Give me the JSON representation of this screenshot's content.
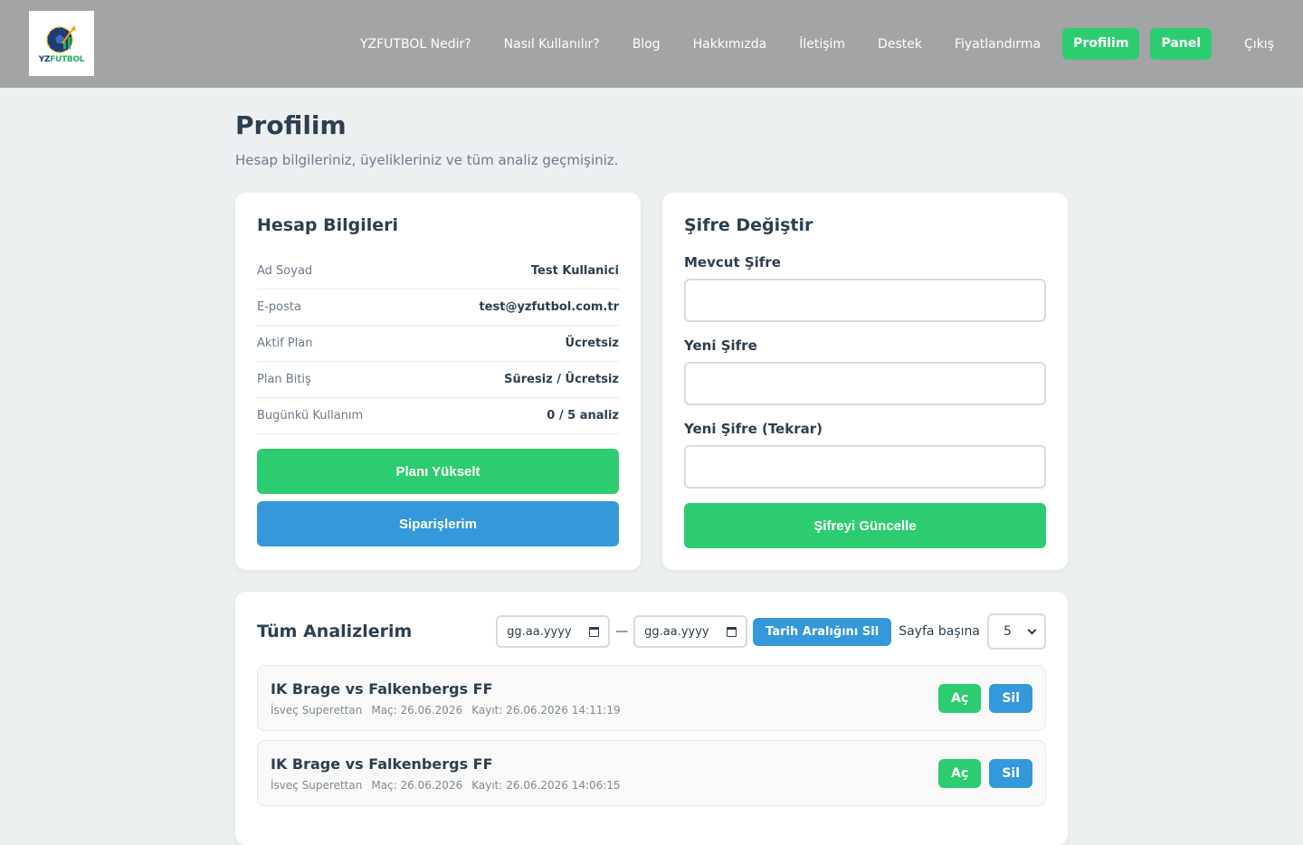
{
  "header": {
    "logo_text_a": "YZ",
    "logo_text_b": "FUTBOL",
    "nav": [
      {
        "label": "YZFUTBOL Nedir?"
      },
      {
        "label": "Nasıl Kullanılır?"
      },
      {
        "label": "Blog"
      },
      {
        "label": "Hakkımızda"
      },
      {
        "label": "İletişim"
      },
      {
        "label": "Destek"
      },
      {
        "label": "Fiyatlandırma"
      },
      {
        "label": "Profilim"
      },
      {
        "label": "Panel"
      },
      {
        "label": "Çıkış"
      }
    ]
  },
  "page": {
    "title": "Profilim",
    "subtitle": "Hesap bilgileriniz, üyelikleriniz ve tüm analiz geçmişiniz."
  },
  "account": {
    "title": "Hesap Bilgileri",
    "rows": [
      {
        "key": "Ad Soyad",
        "value": "Test Kullanici"
      },
      {
        "key": "E-posta",
        "value": "test@yzfutbol.com.tr"
      },
      {
        "key": "Aktif Plan",
        "value": "Ücretsiz"
      },
      {
        "key": "Plan Bitiş",
        "value": "Süresiz / Ücretsiz"
      },
      {
        "key": "Bugünkü Kullanım",
        "value": "0 / 5 analiz"
      }
    ],
    "upgrade_label": "Planı Yükselt",
    "orders_label": "Siparişlerim"
  },
  "password": {
    "title": "Şifre Değiştir",
    "current_label": "Mevcut Şifre",
    "new_label": "Yeni Şifre",
    "repeat_label": "Yeni Şifre (Tekrar)",
    "submit_label": "Şifreyi Güncelle"
  },
  "analyses": {
    "title": "Tüm Analizlerim",
    "date_from_placeholder": "gg.aa.yyyy",
    "date_to_placeholder": "gg.aa.yyyy",
    "date_separator": "—",
    "clear_range_label": "Tarih Aralığını Sil",
    "per_page_label": "Sayfa başına",
    "per_page_value": "5",
    "items": [
      {
        "title": "IK Brage vs Falkenbergs FF",
        "league": "İsveç Superettan",
        "match": "Maç: 26.06.2026",
        "saved": "Kayıt: 26.06.2026 14:11:19",
        "open_label": "Aç",
        "delete_label": "Sil"
      },
      {
        "title": "IK Brage vs Falkenbergs FF",
        "league": "İsveç Superettan",
        "match": "Maç: 26.06.2026",
        "saved": "Kayıt: 26.06.2026 14:06:15",
        "open_label": "Aç",
        "delete_label": "Sil"
      }
    ]
  },
  "colors": {
    "green": "#2ecc71",
    "blue": "#3498db",
    "header_bg": "#a3a4a6",
    "page_bg": "#ecf0f1"
  }
}
